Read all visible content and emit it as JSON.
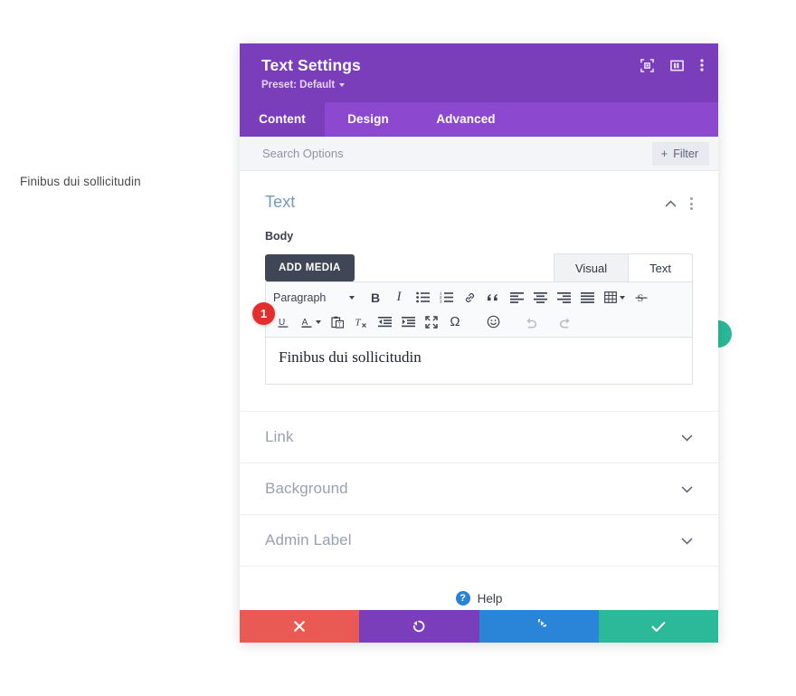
{
  "background": {
    "body_text": "Finibus dui sollicitudin"
  },
  "modal": {
    "title": "Text Settings",
    "preset_label": "Preset: Default",
    "header_icons": [
      {
        "name": "focus-target-icon",
        "glyph": "focus"
      },
      {
        "name": "layout-panel-icon",
        "glyph": "panel"
      },
      {
        "name": "kebab-menu-icon",
        "glyph": "kebab"
      }
    ],
    "tabs": [
      {
        "label": "Content",
        "active": true
      },
      {
        "label": "Design",
        "active": false
      },
      {
        "label": "Advanced",
        "active": false
      }
    ],
    "search": {
      "placeholder": "Search Options",
      "value": "",
      "filter_label": "Filter",
      "filter_icon": "plus-icon"
    },
    "sections": {
      "text": {
        "title": "Text",
        "collapse_icon": "chevron-up-icon",
        "menu_icon": "kebab-menu-icon",
        "field_label": "Body",
        "add_media_label": "ADD MEDIA",
        "editor_tabs": [
          {
            "label": "Visual",
            "active": true
          },
          {
            "label": "Text",
            "active": false
          }
        ],
        "format_select": "Paragraph",
        "toolbar_row1": [
          {
            "name": "bold-icon",
            "label": "B"
          },
          {
            "name": "italic-icon",
            "label": "I"
          },
          {
            "name": "bulleted-list-icon",
            "label": ""
          },
          {
            "name": "numbered-list-icon",
            "label": ""
          },
          {
            "name": "link-icon",
            "label": ""
          },
          {
            "name": "blockquote-icon",
            "label": ""
          },
          {
            "name": "align-left-icon",
            "label": ""
          },
          {
            "name": "align-center-icon",
            "label": ""
          },
          {
            "name": "align-right-icon",
            "label": ""
          },
          {
            "name": "align-justify-icon",
            "label": ""
          },
          {
            "name": "table-icon",
            "label": ""
          },
          {
            "name": "strikethrough-icon",
            "label": "S"
          }
        ],
        "toolbar_row2": [
          {
            "name": "underline-icon",
            "label": "U"
          },
          {
            "name": "text-color-icon",
            "label": "A"
          },
          {
            "name": "paste-as-text-icon",
            "label": ""
          },
          {
            "name": "clear-formatting-icon",
            "label": ""
          },
          {
            "name": "outdent-icon",
            "label": ""
          },
          {
            "name": "indent-icon",
            "label": ""
          },
          {
            "name": "fullscreen-icon",
            "label": ""
          },
          {
            "name": "special-character-icon",
            "label": "Ω"
          },
          {
            "name": "emoji-icon",
            "label": ""
          },
          {
            "name": "undo-icon",
            "label": ""
          },
          {
            "name": "redo-icon",
            "label": ""
          }
        ],
        "editor_content": "Finibus dui sollicitudin",
        "step_badge": "1"
      },
      "collapsed": [
        {
          "title": "Link",
          "icon": "chevron-down-icon"
        },
        {
          "title": "Background",
          "icon": "chevron-down-icon"
        },
        {
          "title": "Admin Label",
          "icon": "chevron-down-icon"
        }
      ]
    },
    "help": {
      "label": "Help",
      "icon": "question-mark-icon"
    },
    "footer_buttons": [
      {
        "name": "cancel-button",
        "icon": "close-icon",
        "color": "#ea5a54"
      },
      {
        "name": "undo-button",
        "icon": "undo-icon",
        "color": "#7b3ebb"
      },
      {
        "name": "redo-button",
        "icon": "redo-icon",
        "color": "#2a85d8"
      },
      {
        "name": "save-button",
        "icon": "check-icon",
        "color": "#2bb99a"
      }
    ]
  },
  "colors": {
    "header_purple": "#7b3ebb",
    "tab_purple": "#8c49cf",
    "section_title_blue": "#6f9bbf",
    "badge_red": "#e32e2e",
    "save_teal": "#2bb99a"
  }
}
